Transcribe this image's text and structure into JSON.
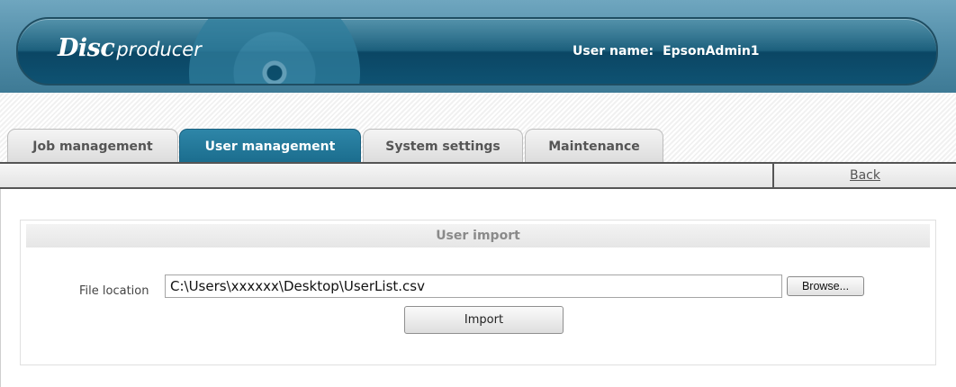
{
  "header": {
    "logo_disc": "Disc",
    "logo_producer": "producer",
    "user_label": "User name:",
    "user_name": "EpsonAdmin1"
  },
  "tabs": [
    {
      "label": "Job management",
      "active": false
    },
    {
      "label": "User management",
      "active": true
    },
    {
      "label": "System settings",
      "active": false
    },
    {
      "label": "Maintenance",
      "active": false
    }
  ],
  "toolbar": {
    "back_label": "Back"
  },
  "panel": {
    "title": "User import",
    "file_location_label": "File location",
    "file_location_value": "C:\\Users\\xxxxxx\\Desktop\\UserList.csv",
    "browse_label": "Browse...",
    "import_label": "Import"
  },
  "colors": {
    "header_blue": "#145a78",
    "active_tab": "#1b6d8e",
    "text_gray": "#555555"
  }
}
